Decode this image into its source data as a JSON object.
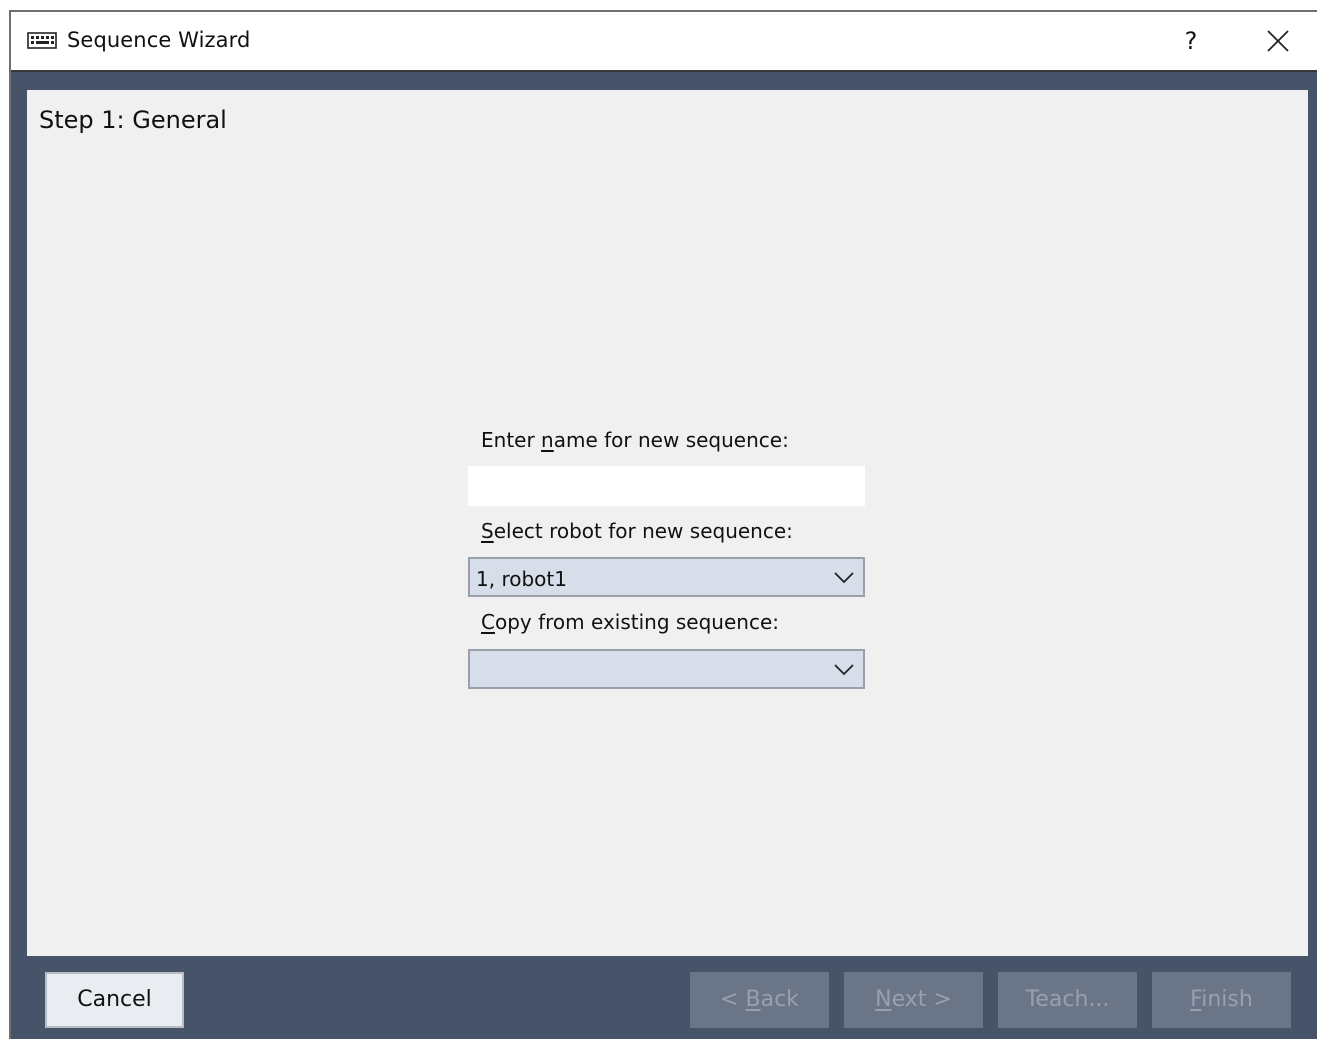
{
  "window": {
    "title": "Sequence Wizard",
    "help_label": "?"
  },
  "step": {
    "title": "Step 1: General"
  },
  "form": {
    "name_label_pre": "Enter ",
    "name_label_mnemonic": "n",
    "name_label_post": "ame for new sequence:",
    "name_value": "",
    "robot_label_mnemonic": "S",
    "robot_label_post": "elect robot for new sequence:",
    "robot_selected": "1, robot1",
    "copy_label_mnemonic": "C",
    "copy_label_post": "opy from existing sequence:",
    "copy_selected": ""
  },
  "buttons": {
    "cancel": "Cancel",
    "back_pre": "< ",
    "back_mnemonic": "B",
    "back_post": "ack",
    "next_mnemonic": "N",
    "next_post": "ext >",
    "teach": "Teach...",
    "finish_mnemonic": "F",
    "finish_post": "inish"
  },
  "colors": {
    "frame": "#475369",
    "content_bg": "#f0f0f0",
    "combo_bg": "#d7dde9",
    "disabled_button": "#6b7588"
  },
  "icons": {
    "app": "keyboard-icon",
    "help": "help-icon",
    "close": "close-icon",
    "dropdown": "chevron-down-icon"
  }
}
